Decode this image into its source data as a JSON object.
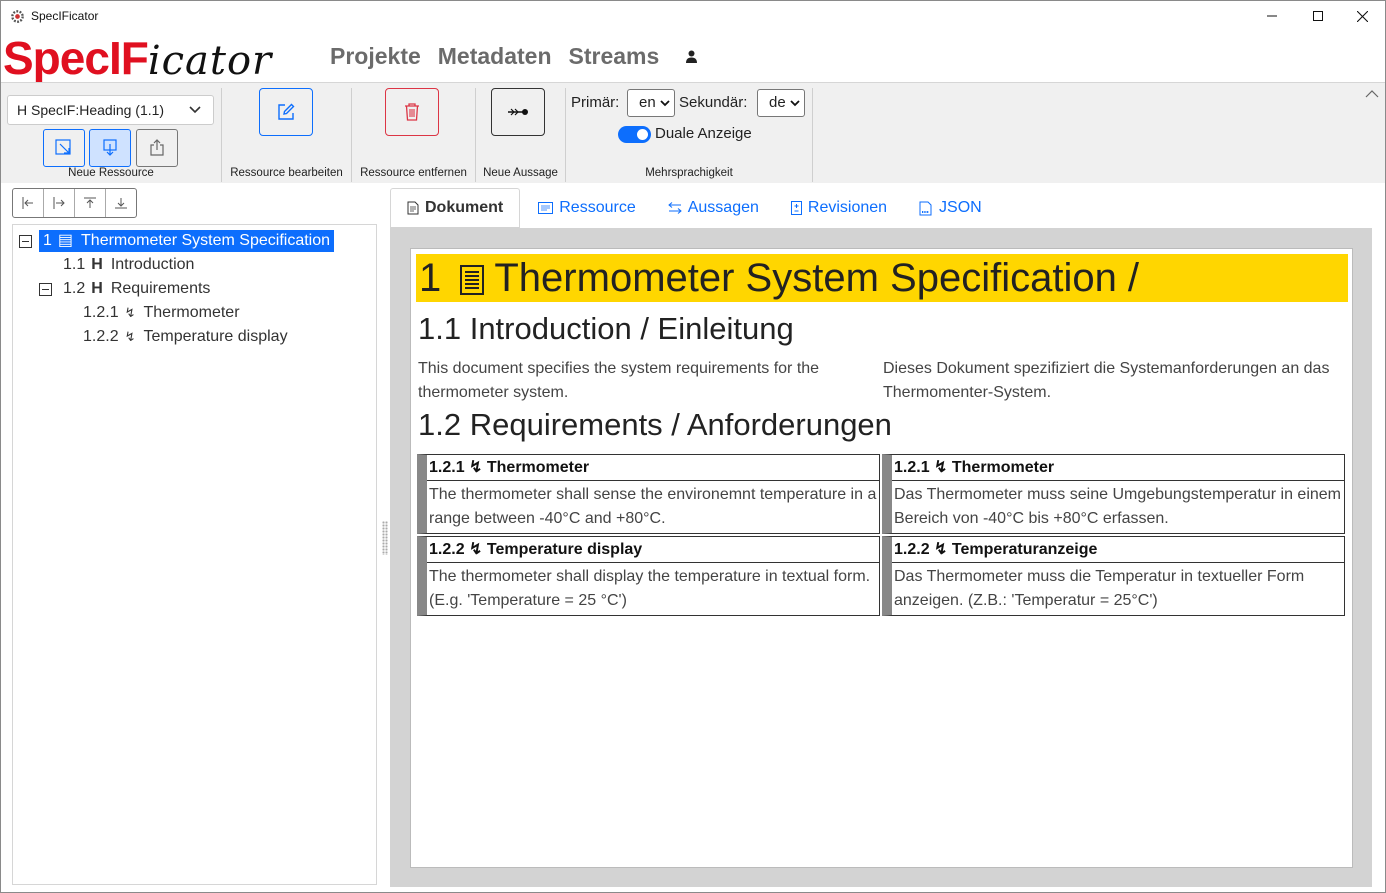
{
  "window": {
    "title": "SpecIFicator",
    "app_icon": "gear-icon",
    "controls": [
      "minimize-icon",
      "maximize-icon",
      "close-icon"
    ]
  },
  "brand": {
    "logo_text": "SpecIFicator",
    "logo_prefix": "SpecIF",
    "logo_suffix": "icator",
    "prefix_color": "#e01020",
    "suffix_color": "#111111"
  },
  "nav": {
    "items": [
      "Projekte",
      "Metadaten",
      "Streams"
    ],
    "user_icon": "user-icon"
  },
  "ribbon": {
    "new_resource": {
      "type_select_value": "H SpecIF:Heading (1.1)",
      "label": "Neue Ressource",
      "buttons": [
        "insert-before-icon",
        "insert-below-icon",
        "upload-icon"
      ]
    },
    "edit": {
      "label": "Ressource bearbeiten",
      "icon": "pencil-square-icon"
    },
    "delete": {
      "label": "Ressource entfernen",
      "icon": "trash-icon"
    },
    "statement": {
      "label": "Neue Aussage",
      "icon": "arrow-link-icon"
    },
    "languages": {
      "primary_label": "Primär:",
      "primary_value": "en",
      "secondary_label": "Sekundär:",
      "secondary_value": "de",
      "dual_label": "Duale Anzeige",
      "dual_on": true,
      "group_label": "Mehrsprachigkeit"
    },
    "accent": "#0d6efd",
    "danger": "#dc3545"
  },
  "tree": {
    "tools": [
      "outdent-icon",
      "indent-icon",
      "move-up-icon",
      "move-down-icon"
    ],
    "nodes": [
      {
        "num": "1",
        "type": "▤",
        "label": "Thermometer System Specification",
        "selected": true
      },
      {
        "num": "1.1",
        "type": "H",
        "label": "Introduction"
      },
      {
        "num": "1.2",
        "type": "H",
        "label": "Requirements"
      },
      {
        "num": "1.2.1",
        "type": "↯",
        "label": "Thermometer"
      },
      {
        "num": "1.2.2",
        "type": "↯",
        "label": "Temperature display"
      }
    ]
  },
  "tabs": [
    "Dokument",
    "Ressource",
    "Aussagen",
    "Revisionen",
    "JSON"
  ],
  "document": {
    "title_num": "1",
    "title": "Thermometer System Specification /",
    "section1_heading": "1.1 Introduction / Einleitung",
    "section1_text_en": "This document specifies the system requirements for the thermometer system.",
    "section1_text_de": "Dieses Dokument spezifiziert die Systemanforderungen an das Thermomenter-System.",
    "section2_heading": "1.2 Requirements / Anforderungen",
    "requirements": [
      {
        "title_en": "1.2.1 ↯ Thermometer",
        "text_en": "The thermometer shall sense the environemnt temperature in a range between -40°C and +80°C.",
        "title_de": "1.2.1 ↯ Thermometer",
        "text_de": "Das Thermometer muss seine Umgebungstemperatur in einem Bereich von -40°C bis +80°C erfassen."
      },
      {
        "title_en": "1.2.2 ↯ Temperature display",
        "text_en": "The thermometer shall display the temperature in textual form. (E.g. 'Temperature = 25 °C')",
        "title_de": "1.2.2 ↯ Temperaturanzeige",
        "text_de": "Das Thermometer muss die Temperatur in textueller Form anzeigen. (Z.B.: 'Temperatur = 25°C')"
      }
    ],
    "heading_color": "#ffd600"
  }
}
